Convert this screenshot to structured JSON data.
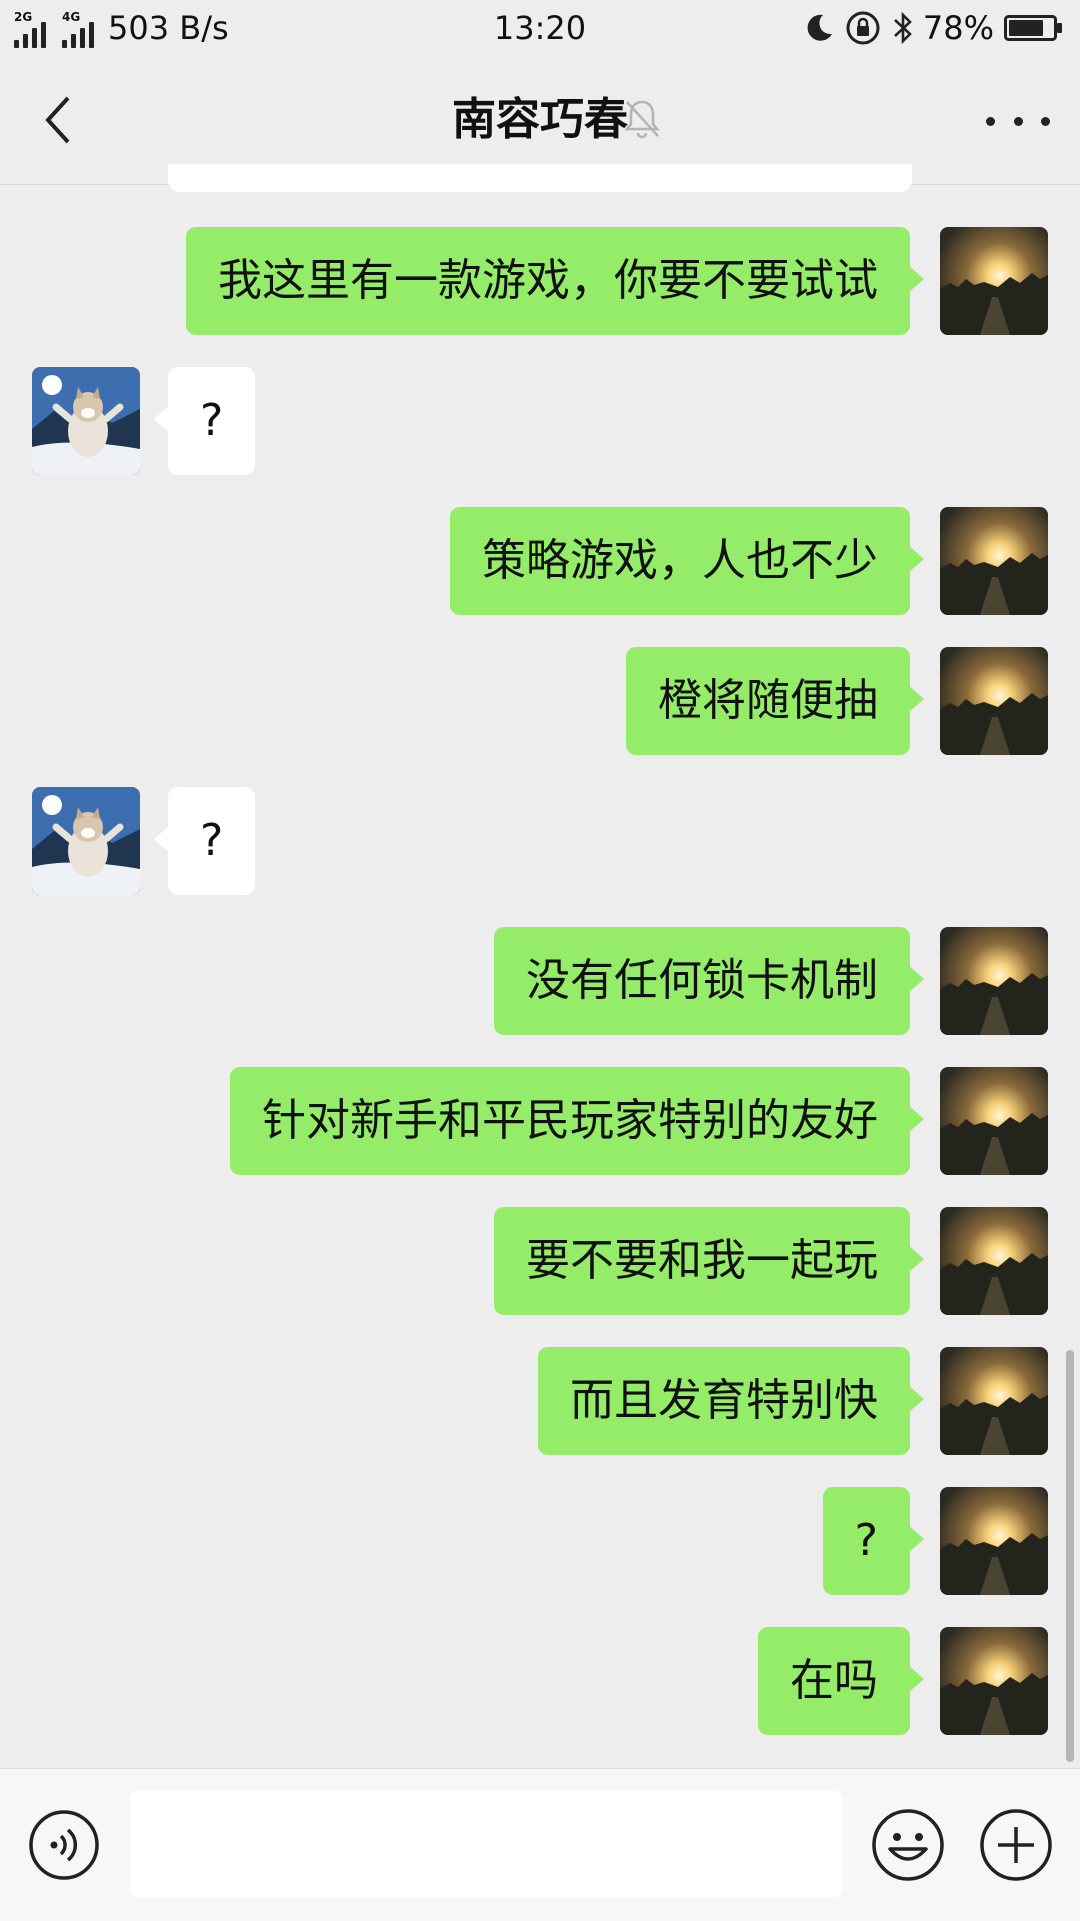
{
  "status_bar": {
    "signal_label_1": "2G",
    "signal_label_2": "4G",
    "net_speed": "503 B/s",
    "time": "13:20",
    "battery": "78%",
    "battery_level": 0.78
  },
  "header": {
    "back_icon": "chevron-left-icon",
    "title": "南容巧春",
    "muted_icon": "bell-off-icon",
    "more_icon": "more-dots-icon"
  },
  "messages": [
    {
      "side": "out",
      "text": "我这里有一款游戏，你要不要试试"
    },
    {
      "side": "in",
      "text": "?"
    },
    {
      "side": "out",
      "text": "策略游戏，人也不少"
    },
    {
      "side": "out",
      "text": "橙将随便抽"
    },
    {
      "side": "in",
      "text": "?"
    },
    {
      "side": "out",
      "text": "没有任何锁卡机制"
    },
    {
      "side": "out",
      "text": "针对新手和平民玩家特别的友好"
    },
    {
      "side": "out",
      "text": "要不要和我一起玩"
    },
    {
      "side": "out",
      "text": "而且发育特别快"
    },
    {
      "side": "out",
      "text": "?"
    },
    {
      "side": "out",
      "text": "在吗"
    }
  ],
  "input_bar": {
    "voice_icon": "voice-icon",
    "text_value": "",
    "emoji_icon": "emoji-icon",
    "plus_icon": "plus-icon"
  },
  "colors": {
    "outgoing_bubble": "#95ec69",
    "incoming_bubble": "#ffffff",
    "background": "#ededed"
  }
}
